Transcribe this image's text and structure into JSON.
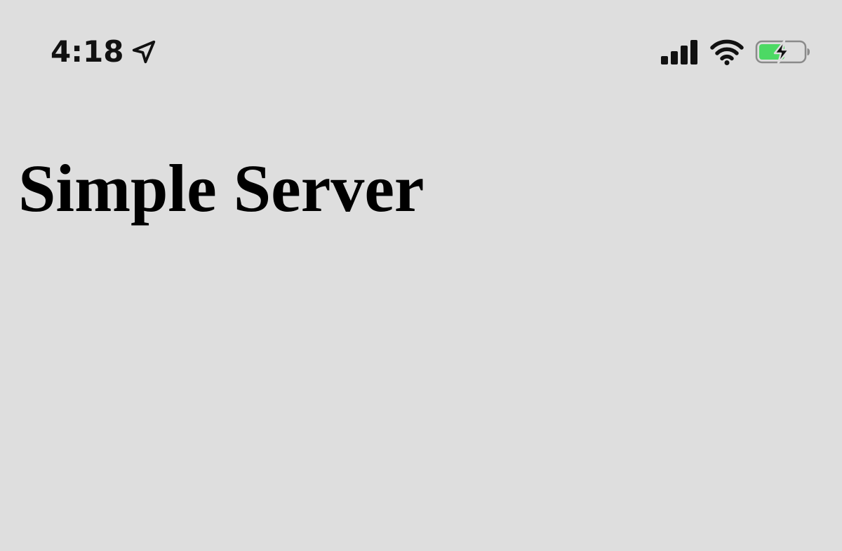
{
  "status_bar": {
    "time": "4:18",
    "icons": {
      "location": "location-arrow-icon",
      "signal": "cellular-signal-icon",
      "wifi": "wifi-icon",
      "battery": "battery-charging-icon"
    },
    "battery_state": "charging",
    "battery_color": "#4cd964"
  },
  "page": {
    "title": "Simple Server",
    "background": "#dedede"
  }
}
